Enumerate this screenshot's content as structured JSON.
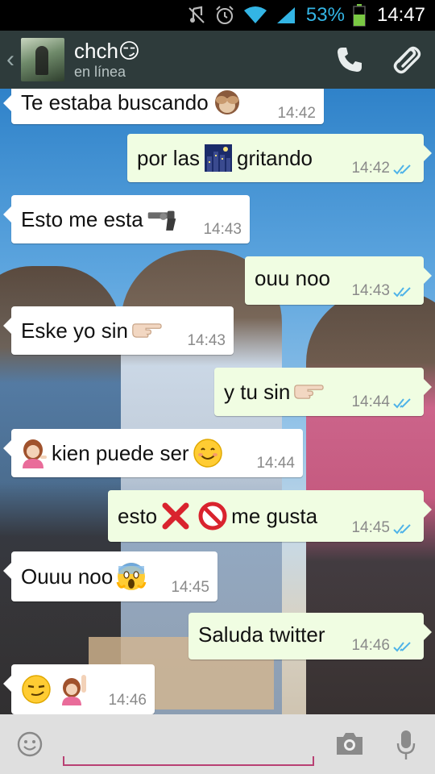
{
  "status_bar": {
    "battery_percent": "53%",
    "time": "14:47",
    "icons": [
      "mute-icon",
      "alarm-icon",
      "wifi-icon",
      "signal-icon",
      "battery-icon"
    ],
    "accent_color": "#33b5e5"
  },
  "header": {
    "contact_name": "chch😏",
    "contact_status": "en línea",
    "icons": [
      "back-chevron-icon",
      "phone-icon",
      "attach-clip-icon"
    ],
    "bar_color": "#2e3b3b"
  },
  "messages": [
    {
      "direction": "in",
      "text": "Te estaba buscando",
      "emoji": "see-no-evil-monkey-icon",
      "time": "14:42"
    },
    {
      "direction": "out",
      "text_before": "por las",
      "emoji": "night-city-icon",
      "text_after": "gritando",
      "time": "14:42",
      "read": true
    },
    {
      "direction": "in",
      "text": "Esto me esta",
      "emoji": "pistol-icon",
      "time": "14:43"
    },
    {
      "direction": "out",
      "text": "ouu noo",
      "time": "14:43",
      "read": true
    },
    {
      "direction": "in",
      "text": "Eske yo sin",
      "emoji": "pointing-right-icon",
      "time": "14:43"
    },
    {
      "direction": "out",
      "text": "y tu sin",
      "emoji": "pointing-right-icon",
      "time": "14:44",
      "read": true
    },
    {
      "direction": "in",
      "emoji_before": "info-desk-girl-icon",
      "text": "kien puede ser",
      "emoji": "smiling-face-icon",
      "time": "14:44"
    },
    {
      "direction": "out",
      "text_before": "esto",
      "emojis": [
        "cross-mark-icon",
        "no-entry-icon"
      ],
      "text_after": "me gusta",
      "time": "14:45",
      "read": true
    },
    {
      "direction": "in",
      "text": "Ouuu noo",
      "emoji": "screaming-face-icon",
      "time": "14:45"
    },
    {
      "direction": "out",
      "text": "Saluda twitter",
      "time": "14:46",
      "read": true
    },
    {
      "direction": "in",
      "emojis": [
        "smirk-face-icon",
        "raising-hand-girl-icon"
      ],
      "time": "14:46"
    }
  ],
  "input_bar": {
    "placeholder": "",
    "icons": [
      "emoji-smiley-icon",
      "camera-icon",
      "microphone-icon"
    ],
    "accent_color": "#b84073"
  },
  "colors": {
    "incoming_bubble": "#ffffff",
    "outgoing_bubble": "#f0fde2",
    "read_ticks": "#4fb3e8"
  }
}
